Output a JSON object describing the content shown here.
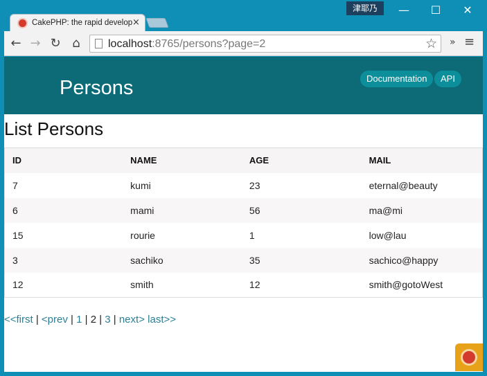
{
  "titlebar": {
    "user_badge": "津耶乃",
    "minimize_glyph": "—",
    "maximize_glyph": "☐",
    "close_glyph": "✕"
  },
  "tab": {
    "title": "CakePHP: the rapid development",
    "close_glyph": "×",
    "favicon": "cakephp-logo-icon"
  },
  "toolbar": {
    "back_glyph": "←",
    "forward_glyph": "→",
    "reload_glyph": "↻",
    "home_glyph": "⌂",
    "url_host": "localhost",
    "url_rest": ":8765/persons?page=2",
    "star_glyph": "☆",
    "ext_glyph": "»",
    "menu_glyph": "≡"
  },
  "site": {
    "title": "Persons",
    "links": {
      "documentation": "Documentation",
      "api": "API"
    },
    "brand_color": "#0c6b77"
  },
  "main": {
    "heading": "List Persons",
    "table": {
      "headers": [
        "ID",
        "NAME",
        "AGE",
        "MAIL"
      ],
      "rows": [
        [
          "7",
          "kumi",
          "23",
          "eternal@beauty"
        ],
        [
          "6",
          "mami",
          "56",
          "ma@mi"
        ],
        [
          "15",
          "rourie",
          "1",
          "low@lau"
        ],
        [
          "3",
          "sachiko",
          "35",
          "sachico@happy"
        ],
        [
          "12",
          "smith",
          "12",
          "smith@gotoWest"
        ]
      ]
    },
    "paginator": {
      "first": "<<first",
      "prev": "<prev",
      "page1": "1",
      "current": "2",
      "page3": "3",
      "next": "next>",
      "last": "last>>",
      "sep": " | "
    }
  }
}
